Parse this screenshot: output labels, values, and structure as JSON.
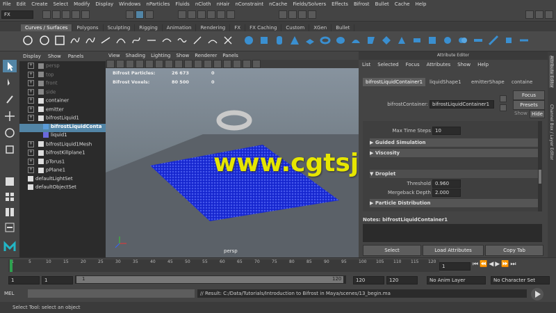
{
  "menubar": [
    "File",
    "Edit",
    "Create",
    "Select",
    "Modify",
    "Display",
    "Windows",
    "nParticles",
    "Fluids",
    "nCloth",
    "nHair",
    "nConstraint",
    "nCache",
    "Fields/Solvers",
    "Effects",
    "Bifrost",
    "Bullet",
    "Cache",
    "Help"
  ],
  "menuset": "FX",
  "shelf_tabs": [
    "Curves / Surfaces",
    "Polygons",
    "Sculpting",
    "Rigging",
    "Animation",
    "Rendering",
    "FX",
    "FX Caching",
    "Custom",
    "XGen",
    "Bullet"
  ],
  "shelf_active": "Curves / Surfaces",
  "outliner": {
    "menu": [
      "Display",
      "Show",
      "Panels"
    ],
    "items": [
      {
        "label": "persp",
        "dim": true
      },
      {
        "label": "top",
        "dim": true
      },
      {
        "label": "front",
        "dim": true
      },
      {
        "label": "side",
        "dim": true
      },
      {
        "label": "container",
        "dim": false
      },
      {
        "label": "emitter",
        "dim": false
      },
      {
        "label": "bifrostLiquid1",
        "dim": false
      },
      {
        "label": "bifrostLiquidConta",
        "dim": false,
        "selected": true
      },
      {
        "label": "liquid1",
        "dim": false
      },
      {
        "label": "bifrostLiquid1Mesh",
        "dim": false
      },
      {
        "label": "bifrostKillplane1",
        "dim": false
      },
      {
        "label": "pTorus1",
        "dim": false
      },
      {
        "label": "pPlane1",
        "dim": false
      },
      {
        "label": "defaultLightSet",
        "dim": false
      },
      {
        "label": "defaultObjectSet",
        "dim": false
      }
    ]
  },
  "viewport": {
    "menu": [
      "View",
      "Shading",
      "Lighting",
      "Show",
      "Renderer",
      "Panels"
    ],
    "hud": [
      {
        "label": "Bifrost Particles:",
        "value": "26 673",
        "extra": "0"
      },
      {
        "label": "Bifrost Voxels:",
        "value": "80 500",
        "extra": "0"
      }
    ],
    "camera": "persp",
    "watermark": "www.cgtsj.com"
  },
  "attribute_editor": {
    "title": "Attribute Editor",
    "menu": [
      "List",
      "Selected",
      "Focus",
      "Attributes",
      "Show",
      "Help"
    ],
    "tabs": [
      "bifrostLiquidContainer1",
      "liquidShape1",
      "emitterShape",
      "containe"
    ],
    "node_label": "bifrostContainer:",
    "node_value": "bifrostLiquidContainer1",
    "focus_btn": "Focus",
    "presets_btn": "Presets",
    "show_btn": "Show",
    "hide_btn": "Hide",
    "max_time_steps_label": "Max Time Steps",
    "max_time_steps_value": "10",
    "sections": [
      "Guided Simulation",
      "Viscosity",
      "Droplet",
      "Particle Distribution"
    ],
    "threshold_label": "Threshold",
    "threshold_value": "0.960",
    "mergeback_label": "Mergeback Depth",
    "mergeback_value": "2.000",
    "notes": "Notes:  bifrostLiquidContainer1",
    "bottom_buttons": [
      "Select",
      "Load Attributes",
      "Copy Tab"
    ],
    "side_tabs": [
      "Attribute Editor",
      "Channel Box / Layer Editor"
    ]
  },
  "timeline": {
    "ticks": [
      "1",
      "5",
      "10",
      "15",
      "20",
      "25",
      "30",
      "35",
      "40",
      "45",
      "50",
      "55",
      "60",
      "65",
      "70",
      "75",
      "80",
      "85",
      "90",
      "95",
      "100",
      "105",
      "110",
      "115",
      "120"
    ],
    "current": "1"
  },
  "range": {
    "start": "1",
    "start2": "1",
    "slider_start": "1",
    "slider_end": "120",
    "end": "120",
    "end2": "120",
    "anim_layer": "No Anim Layer",
    "char_set": "No Character Set"
  },
  "command_line": {
    "label": "MEL",
    "result": "// Result: C:/Data/Tutorials/Introduction to Bifrost in Maya/scenes/13_begin.ma"
  },
  "help_line": "Select Tool: select an object",
  "colors": {
    "accent": "#5285a6",
    "selected_row": "#5285a6",
    "water": "#1a2bd8"
  }
}
